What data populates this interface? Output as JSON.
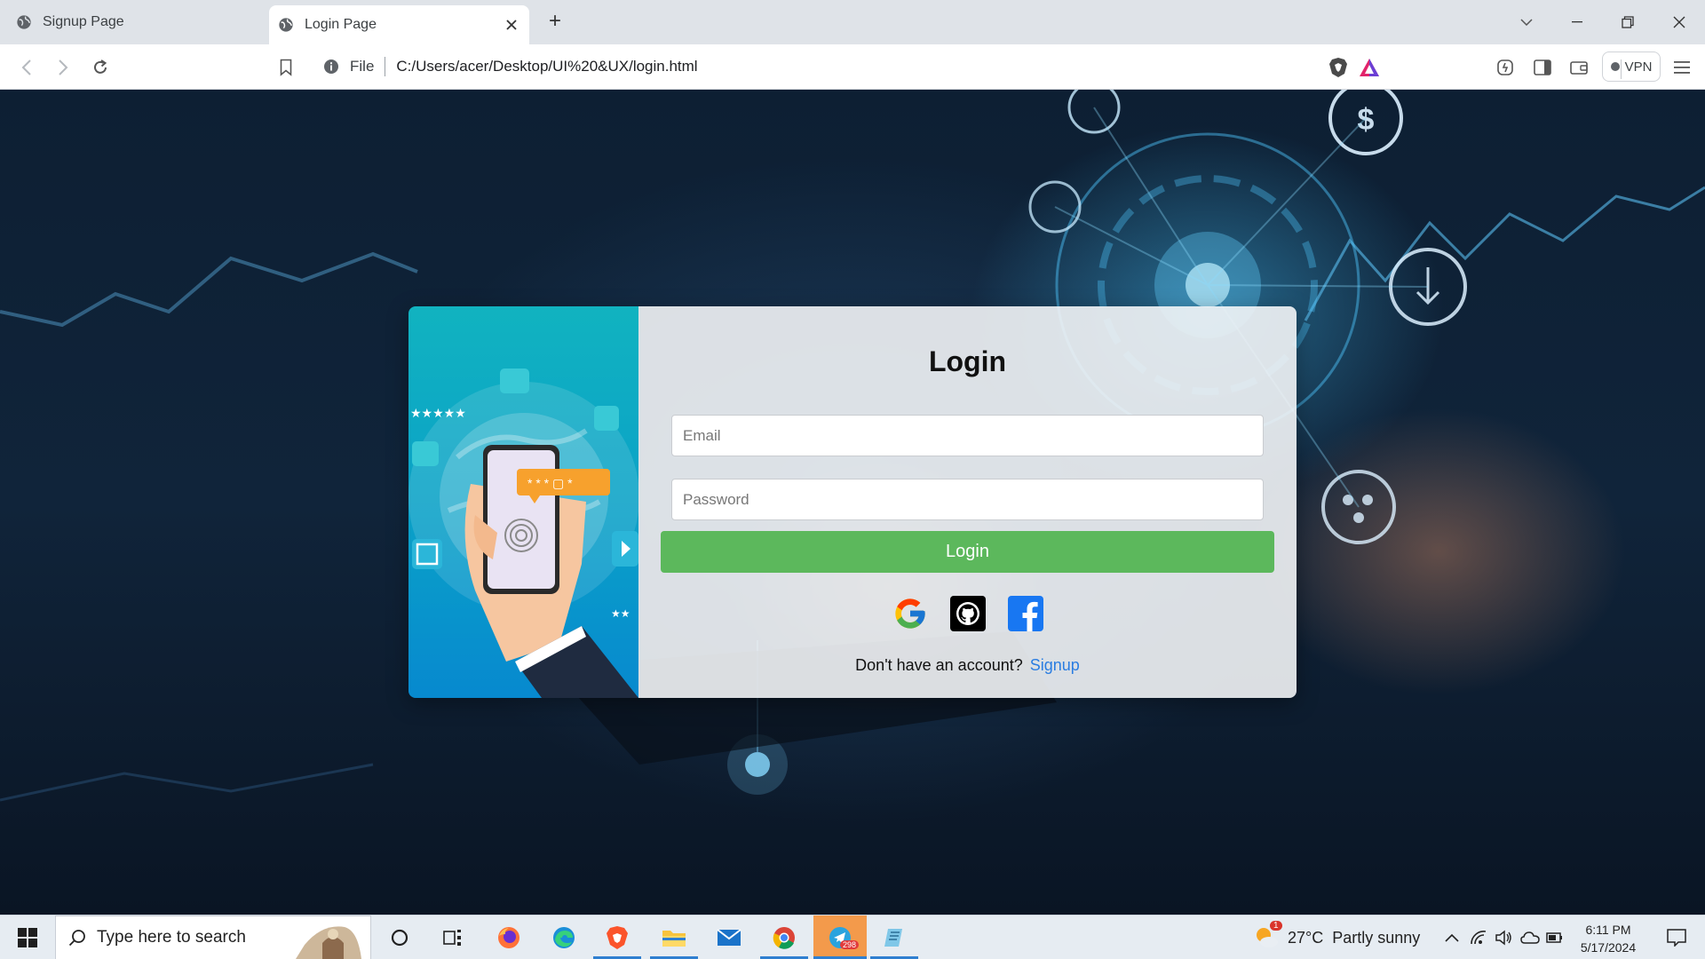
{
  "browser": {
    "tabs": [
      {
        "title": "Signup Page",
        "active": false
      },
      {
        "title": "Login Page",
        "active": true
      }
    ],
    "new_tab_label": "+",
    "address": {
      "scheme_label": "File",
      "url": "C:/Users/acer/Desktop/UI%20&UX/login.html"
    },
    "vpn_label": "VPN"
  },
  "login_card": {
    "title": "Login",
    "email_placeholder": "Email",
    "password_placeholder": "Password",
    "login_button": "Login",
    "social_icons": [
      "google-icon",
      "github-icon",
      "facebook-icon"
    ],
    "signup_prompt": "Don't have an account?",
    "signup_link": "Signup",
    "colors": {
      "button": "#5cb85c",
      "link": "#2a7de1",
      "illustration": "#0aa0c8"
    }
  },
  "taskbar": {
    "search_placeholder": "Type here to search",
    "weather_temp": "27°C",
    "weather_text": "Partly sunny",
    "telegram_badge": "298",
    "weather_badge": "1",
    "time": "6:11 PM",
    "date": "5/17/2024"
  }
}
